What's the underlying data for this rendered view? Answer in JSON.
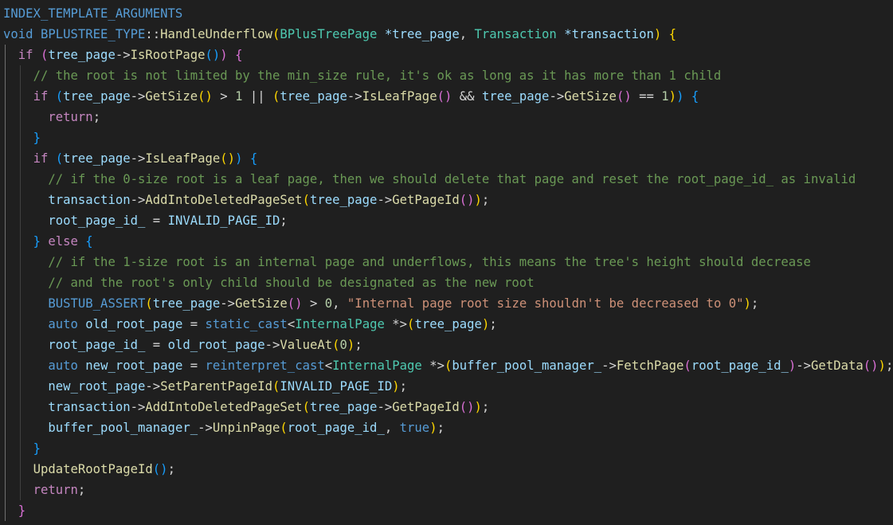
{
  "editor": {
    "theme_colors": {
      "background": "#1f1f1f",
      "keyword": "#569cd6",
      "control": "#c586c0",
      "type": "#4ec9b0",
      "function": "#dcdcaa",
      "variable": "#9cdcfe",
      "number": "#b5cea8",
      "string": "#ce9178",
      "comment": "#6a9955",
      "bracket_1": "#ffd700",
      "bracket_2": "#da70d6",
      "bracket_3": "#179fff"
    },
    "lines": [
      [
        {
          "t": "INDEX_TEMPLATE_ARGUMENTS",
          "c": "macro"
        }
      ],
      [
        {
          "t": "void",
          "c": "kw"
        },
        {
          "t": " "
        },
        {
          "t": "BPLUSTREE_TYPE",
          "c": "macro"
        },
        {
          "t": "::"
        },
        {
          "t": "HandleUnderflow",
          "c": "fn"
        },
        {
          "t": "(",
          "c": "p0"
        },
        {
          "t": "BPlusTreePage",
          "c": "type"
        },
        {
          "t": " "
        },
        {
          "t": "*tree_page",
          "c": "var"
        },
        {
          "t": ", "
        },
        {
          "t": "Transaction",
          "c": "type"
        },
        {
          "t": " "
        },
        {
          "t": "*transaction",
          "c": "var"
        },
        {
          "t": ")",
          "c": "p0"
        },
        {
          "t": " "
        },
        {
          "t": "{",
          "c": "p0"
        }
      ],
      [
        {
          "t": "  "
        },
        {
          "t": "if",
          "c": "ctrl"
        },
        {
          "t": " "
        },
        {
          "t": "(",
          "c": "p1"
        },
        {
          "t": "tree_page",
          "c": "var"
        },
        {
          "t": "->"
        },
        {
          "t": "IsRootPage",
          "c": "fn"
        },
        {
          "t": "()",
          "c": "p2"
        },
        {
          "t": ")",
          "c": "p1"
        },
        {
          "t": " "
        },
        {
          "t": "{",
          "c": "p1"
        }
      ],
      [
        {
          "t": "    "
        },
        {
          "t": "// the root is not limited by the min_size rule, it's ok as long as it has more than 1 child",
          "c": "cmt"
        }
      ],
      [
        {
          "t": "    "
        },
        {
          "t": "if",
          "c": "ctrl"
        },
        {
          "t": " "
        },
        {
          "t": "(",
          "c": "p2"
        },
        {
          "t": "tree_page",
          "c": "var"
        },
        {
          "t": "->"
        },
        {
          "t": "GetSize",
          "c": "fn"
        },
        {
          "t": "()",
          "c": "p0"
        },
        {
          "t": " > "
        },
        {
          "t": "1",
          "c": "num"
        },
        {
          "t": " || "
        },
        {
          "t": "(",
          "c": "p0"
        },
        {
          "t": "tree_page",
          "c": "var"
        },
        {
          "t": "->"
        },
        {
          "t": "IsLeafPage",
          "c": "fn"
        },
        {
          "t": "()",
          "c": "p1"
        },
        {
          "t": " && "
        },
        {
          "t": "tree_page",
          "c": "var"
        },
        {
          "t": "->"
        },
        {
          "t": "GetSize",
          "c": "fn"
        },
        {
          "t": "()",
          "c": "p1"
        },
        {
          "t": " == "
        },
        {
          "t": "1",
          "c": "num"
        },
        {
          "t": ")",
          "c": "p0"
        },
        {
          "t": ")",
          "c": "p2"
        },
        {
          "t": " "
        },
        {
          "t": "{",
          "c": "p2"
        }
      ],
      [
        {
          "t": "      "
        },
        {
          "t": "return",
          "c": "ctrl"
        },
        {
          "t": ";"
        }
      ],
      [
        {
          "t": "    "
        },
        {
          "t": "}",
          "c": "p2"
        }
      ],
      [
        {
          "t": "    "
        },
        {
          "t": "if",
          "c": "ctrl"
        },
        {
          "t": " "
        },
        {
          "t": "(",
          "c": "p2"
        },
        {
          "t": "tree_page",
          "c": "var"
        },
        {
          "t": "->"
        },
        {
          "t": "IsLeafPage",
          "c": "fn"
        },
        {
          "t": "()",
          "c": "p0"
        },
        {
          "t": ")",
          "c": "p2"
        },
        {
          "t": " "
        },
        {
          "t": "{",
          "c": "p2"
        }
      ],
      [
        {
          "t": "      "
        },
        {
          "t": "// if the 0-size root is a leaf page, then we should delete that page and reset the root_page_id_ as invalid",
          "c": "cmt"
        }
      ],
      [
        {
          "t": "      "
        },
        {
          "t": "transaction",
          "c": "var"
        },
        {
          "t": "->"
        },
        {
          "t": "AddIntoDeletedPageSet",
          "c": "fn"
        },
        {
          "t": "(",
          "c": "p0"
        },
        {
          "t": "tree_page",
          "c": "var"
        },
        {
          "t": "->"
        },
        {
          "t": "GetPageId",
          "c": "fn"
        },
        {
          "t": "()",
          "c": "p1"
        },
        {
          "t": ")",
          "c": "p0"
        },
        {
          "t": ";"
        }
      ],
      [
        {
          "t": "      "
        },
        {
          "t": "root_page_id_",
          "c": "var"
        },
        {
          "t": " = "
        },
        {
          "t": "INVALID_PAGE_ID",
          "c": "var"
        },
        {
          "t": ";"
        }
      ],
      [
        {
          "t": "    "
        },
        {
          "t": "}",
          "c": "p2"
        },
        {
          "t": " "
        },
        {
          "t": "else",
          "c": "ctrl"
        },
        {
          "t": " "
        },
        {
          "t": "{",
          "c": "p2"
        }
      ],
      [
        {
          "t": "      "
        },
        {
          "t": "// if the 1-size root is an internal page and underflows, this means the tree's height should decrease",
          "c": "cmt"
        }
      ],
      [
        {
          "t": "      "
        },
        {
          "t": "// and the root's only child should be designated as the new root",
          "c": "cmt"
        }
      ],
      [
        {
          "t": "      "
        },
        {
          "t": "BUSTUB_ASSERT",
          "c": "macro"
        },
        {
          "t": "(",
          "c": "p0"
        },
        {
          "t": "tree_page",
          "c": "var"
        },
        {
          "t": "->"
        },
        {
          "t": "GetSize",
          "c": "fn"
        },
        {
          "t": "()",
          "c": "p1"
        },
        {
          "t": " > "
        },
        {
          "t": "0",
          "c": "num"
        },
        {
          "t": ", "
        },
        {
          "t": "\"Internal page root size shouldn't be decreased to 0\"",
          "c": "str"
        },
        {
          "t": ")",
          "c": "p0"
        },
        {
          "t": ";"
        }
      ],
      [
        {
          "t": "      "
        },
        {
          "t": "auto",
          "c": "kw"
        },
        {
          "t": " "
        },
        {
          "t": "old_root_page",
          "c": "var"
        },
        {
          "t": " = "
        },
        {
          "t": "static_cast",
          "c": "kw"
        },
        {
          "t": "<"
        },
        {
          "t": "InternalPage",
          "c": "type"
        },
        {
          "t": " *>"
        },
        {
          "t": "(",
          "c": "p0"
        },
        {
          "t": "tree_page",
          "c": "var"
        },
        {
          "t": ")",
          "c": "p0"
        },
        {
          "t": ";"
        }
      ],
      [
        {
          "t": "      "
        },
        {
          "t": "root_page_id_",
          "c": "var"
        },
        {
          "t": " = "
        },
        {
          "t": "old_root_page",
          "c": "var"
        },
        {
          "t": "->"
        },
        {
          "t": "ValueAt",
          "c": "fn"
        },
        {
          "t": "(",
          "c": "p0"
        },
        {
          "t": "0",
          "c": "num"
        },
        {
          "t": ")",
          "c": "p0"
        },
        {
          "t": ";"
        }
      ],
      [
        {
          "t": "      "
        },
        {
          "t": "auto",
          "c": "kw"
        },
        {
          "t": " "
        },
        {
          "t": "new_root_page",
          "c": "var"
        },
        {
          "t": " = "
        },
        {
          "t": "reinterpret_cast",
          "c": "kw"
        },
        {
          "t": "<"
        },
        {
          "t": "InternalPage",
          "c": "type"
        },
        {
          "t": " *>"
        },
        {
          "t": "(",
          "c": "p0"
        },
        {
          "t": "buffer_pool_manager_",
          "c": "var"
        },
        {
          "t": "->"
        },
        {
          "t": "FetchPage",
          "c": "fn"
        },
        {
          "t": "(",
          "c": "p1"
        },
        {
          "t": "root_page_id_",
          "c": "var"
        },
        {
          "t": ")",
          "c": "p1"
        },
        {
          "t": "->"
        },
        {
          "t": "GetData",
          "c": "fn"
        },
        {
          "t": "()",
          "c": "p1"
        },
        {
          "t": ")",
          "c": "p0"
        },
        {
          "t": ";"
        }
      ],
      [
        {
          "t": "      "
        },
        {
          "t": "new_root_page",
          "c": "var"
        },
        {
          "t": "->"
        },
        {
          "t": "SetParentPageId",
          "c": "fn"
        },
        {
          "t": "(",
          "c": "p0"
        },
        {
          "t": "INVALID_PAGE_ID",
          "c": "var"
        },
        {
          "t": ")",
          "c": "p0"
        },
        {
          "t": ";"
        }
      ],
      [
        {
          "t": "      "
        },
        {
          "t": "transaction",
          "c": "var"
        },
        {
          "t": "->"
        },
        {
          "t": "AddIntoDeletedPageSet",
          "c": "fn"
        },
        {
          "t": "(",
          "c": "p0"
        },
        {
          "t": "tree_page",
          "c": "var"
        },
        {
          "t": "->"
        },
        {
          "t": "GetPageId",
          "c": "fn"
        },
        {
          "t": "()",
          "c": "p1"
        },
        {
          "t": ")",
          "c": "p0"
        },
        {
          "t": ";"
        }
      ],
      [
        {
          "t": "      "
        },
        {
          "t": "buffer_pool_manager_",
          "c": "var"
        },
        {
          "t": "->"
        },
        {
          "t": "UnpinPage",
          "c": "fn"
        },
        {
          "t": "(",
          "c": "p0"
        },
        {
          "t": "root_page_id_",
          "c": "var"
        },
        {
          "t": ", "
        },
        {
          "t": "true",
          "c": "kw"
        },
        {
          "t": ")",
          "c": "p0"
        },
        {
          "t": ";"
        }
      ],
      [
        {
          "t": "    "
        },
        {
          "t": "}",
          "c": "p2"
        }
      ],
      [
        {
          "t": "    "
        },
        {
          "t": "UpdateRootPageId",
          "c": "fn"
        },
        {
          "t": "()",
          "c": "p2"
        },
        {
          "t": ";"
        }
      ],
      [
        {
          "t": "    "
        },
        {
          "t": "return",
          "c": "ctrl"
        },
        {
          "t": ";"
        }
      ],
      [
        {
          "t": "  "
        },
        {
          "t": "}",
          "c": "p1"
        }
      ]
    ]
  }
}
